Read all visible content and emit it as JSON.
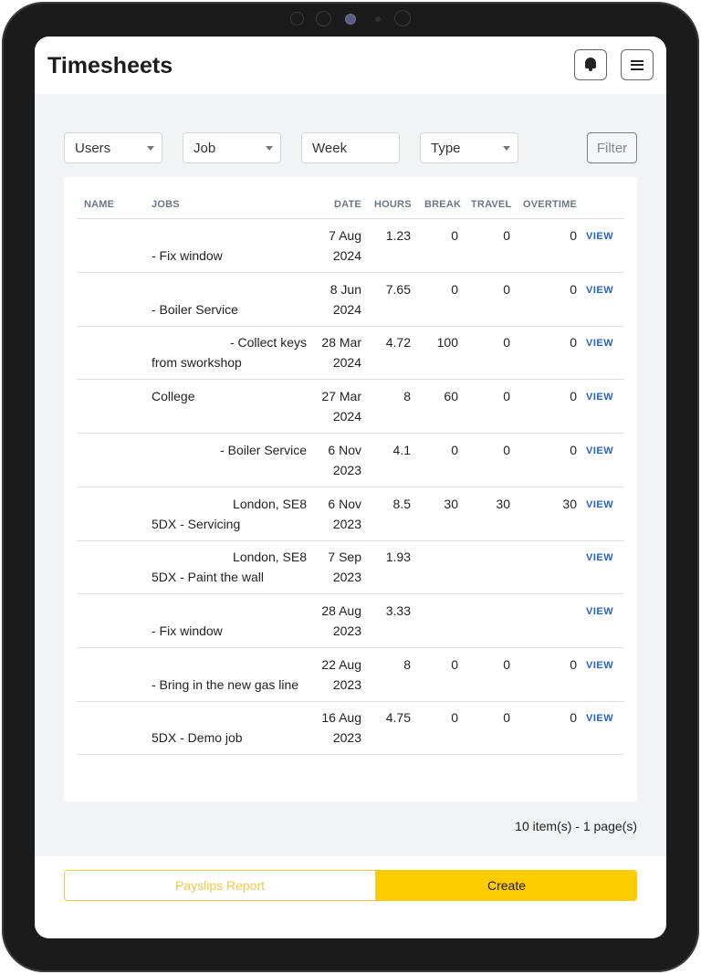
{
  "header": {
    "title": "Timesheets",
    "notifications_icon": "bell-icon",
    "menu_icon": "hamburger-icon"
  },
  "filters": {
    "users": "Users",
    "job": "Job",
    "week": "Week",
    "type": "Type",
    "filter_button": "Filter"
  },
  "table": {
    "columns": [
      "NAME",
      "JOBS",
      "DATE",
      "HOURS",
      "BREAK",
      "TRAVEL",
      "OVERTIME"
    ],
    "rows": [
      {
        "job_l1": "",
        "job_l2": "- Fix window",
        "date_l1": "7 Aug",
        "date_l2": "2024",
        "hours": "1.23",
        "break": "0",
        "travel": "0",
        "overtime": "0",
        "action": "VIEW"
      },
      {
        "job_l1": "",
        "job_l2": "- Boiler Service",
        "date_l1": "8 Jun",
        "date_l2": "2024",
        "hours": "7.65",
        "break": "0",
        "travel": "0",
        "overtime": "0",
        "action": "VIEW"
      },
      {
        "job_l1": "- Collect keys",
        "job_l2": "from sworkshop",
        "date_l1": "28 Mar",
        "date_l2": "2024",
        "hours": "4.72",
        "break": "100",
        "travel": "0",
        "overtime": "0",
        "action": "VIEW"
      },
      {
        "job_l1": "",
        "job_l2": "",
        "job_single": "College",
        "date_l1": "27 Mar",
        "date_l2": "2024",
        "hours": "8",
        "break": "60",
        "travel": "0",
        "overtime": "0",
        "action": "VIEW"
      },
      {
        "job_l1": "- Boiler Service",
        "job_l2": "",
        "date_l1": "6 Nov",
        "date_l2": "2023",
        "hours": "4.1",
        "break": "0",
        "travel": "0",
        "overtime": "0",
        "action": "VIEW"
      },
      {
        "job_l1": "London, SE8",
        "job_l2": "5DX - Servicing",
        "date_l1": "6 Nov",
        "date_l2": "2023",
        "hours": "8.5",
        "break": "30",
        "travel": "30",
        "overtime": "30",
        "action": "VIEW"
      },
      {
        "job_l1": "London, SE8",
        "job_l2": "5DX - Paint the wall",
        "date_l1": "7 Sep",
        "date_l2": "2023",
        "hours": "1.93",
        "break": "",
        "travel": "",
        "overtime": "",
        "action": "VIEW"
      },
      {
        "job_l1": "",
        "job_l2": "- Fix window",
        "date_l1": "28 Aug",
        "date_l2": "2023",
        "hours": "3.33",
        "break": "",
        "travel": "",
        "overtime": "",
        "action": "VIEW"
      },
      {
        "job_l1": "",
        "job_l2": "- Bring in the new gas line",
        "date_l1": "22 Aug",
        "date_l2": "2023",
        "hours": "8",
        "break": "0",
        "travel": "0",
        "overtime": "0",
        "action": "VIEW"
      },
      {
        "job_l1": "",
        "job_l2": "5DX - Demo job",
        "date_l1": "16 Aug",
        "date_l2": "2023",
        "hours": "4.75",
        "break": "0",
        "travel": "0",
        "overtime": "0",
        "action": "VIEW"
      }
    ]
  },
  "pagination": {
    "summary": "10 item(s) - 1 page(s)"
  },
  "footer": {
    "payslips_label": "Payslips Report",
    "create_label": "Create"
  },
  "colors": {
    "accent": "#ffcc00",
    "link": "#2563c4",
    "background": "#f2f3f5"
  }
}
